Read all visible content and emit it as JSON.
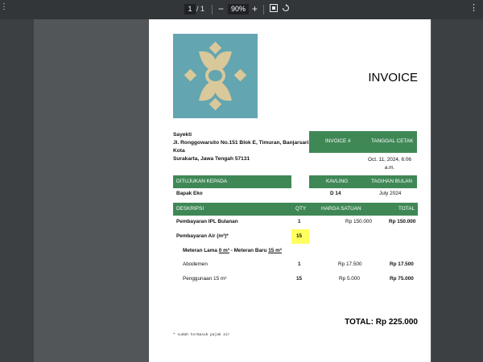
{
  "toolbar": {
    "current_page": "1",
    "page_separator": "/",
    "total_pages": "1",
    "zoom": "90%",
    "zoom_out": "−",
    "zoom_in": "+",
    "left_icon": "sidebar-icon",
    "fit_icon": "fit-page-icon",
    "rotate_icon": "rotate-icon"
  },
  "invoice": {
    "title": "INVOICE",
    "company": {
      "name": "Sayekti",
      "address_lines": [
        "Jl. Ronggowarsito No.151 Blok E, Timuran, Banjarsari, Kota",
        "Surakarta, Jawa Tengah 57131"
      ]
    },
    "headers": {
      "invoice_no": "INVOICE #",
      "print_date": "TANGGAL CETAK",
      "to": "DITUJUKAN KEPADA",
      "kavling": "KAVLING",
      "billing_month": "TAGIHAN BULAN",
      "description": "DESKRIPSI",
      "qty": "QTY",
      "unit_price": "HARGA SATUAN",
      "total": "TOTAL"
    },
    "print_date_lines": [
      "Oct. 11, 2024, 6:06",
      "a.m."
    ],
    "recipient": "Bapak Eko",
    "kavling": "D 14",
    "billing_month": "July 2024",
    "items": {
      "ipl": {
        "desc": "Pembayaran IPL Bulanan",
        "qty": "1",
        "price": "Rp 150.000",
        "total": "Rp 150.000"
      },
      "water": {
        "desc": "Pembayaran Air (m³)*",
        "qty": "15"
      },
      "meter": {
        "prefix": "Meteran Lama ",
        "old": "0 m³",
        "mid": " - Meteran Baru ",
        "new": "15 m³"
      },
      "abodemen": {
        "desc": "Abodemen",
        "qty": "1",
        "price": "Rp 17.500",
        "total": "Rp 17.500"
      },
      "usage": {
        "desc": "Penggunaan 15 m³",
        "qty": "15",
        "price": "Rp 5.000",
        "total": "Rp 75.000"
      }
    },
    "grand_total": "TOTAL: Rp 225.000",
    "footnote": "* sudah termasuk pajak air",
    "colors": {
      "header_green": "#3f8856",
      "logo_bg": "#63a5b0",
      "logo_gold": "#d9c89a",
      "highlight": "#ffff5e"
    }
  }
}
